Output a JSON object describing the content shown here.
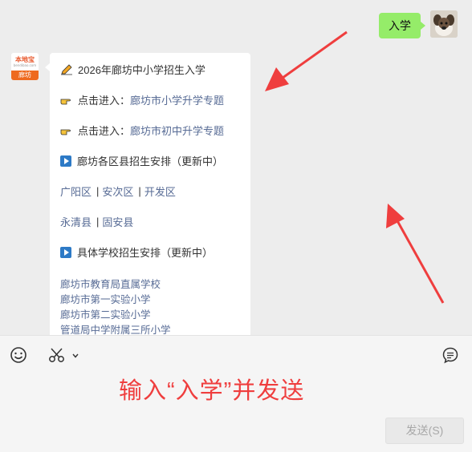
{
  "chat": {
    "outgoing": {
      "text": "入学"
    },
    "bot_avatar": {
      "brand": "本地宝",
      "domain": "bendibao.com",
      "city": "廊坊"
    },
    "incoming": {
      "title": "2026年廊坊中小学招生入学",
      "link1_prefix": "点击进入：",
      "link1_text": "廊坊市小学升学专题",
      "link2_prefix": "点击进入：",
      "link2_text": "廊坊市初中升学专题",
      "section1": "廊坊各区县招生安排（更新中）",
      "districts_row1": [
        "广阳区",
        "安次区",
        "开发区"
      ],
      "districts_row2": [
        "永清县",
        "固安县"
      ],
      "section2": "具体学校招生安排（更新中）",
      "schools": [
        "廊坊市教育局直属学校",
        "廊坊市第一实验小学",
        "廊坊市第二实验小学",
        "管道局中学附属三所小学"
      ]
    }
  },
  "input_area": {
    "hint": "输入“入学”并发送",
    "send_label": "发送(S)"
  },
  "colors": {
    "link": "#576b95",
    "bubble_out": "#95ec69",
    "annotation": "#ef3e3e"
  }
}
